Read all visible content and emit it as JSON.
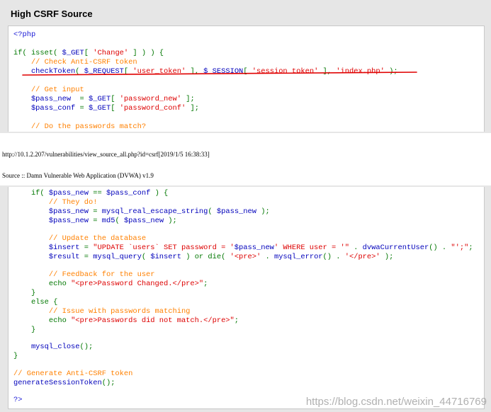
{
  "panel_title": "High CSRF Source",
  "footer_url": "http://10.1.2.207/vulnerabilities/view_source_all.php?id=csrf[2019/1/5 16:38:33]",
  "page_heading": "Source :: Damn Vulnerable Web Application (DVWA) v1.9",
  "watermark": "https://blog.csdn.net/weixin_44716769",
  "colors": {
    "underline": "#e00000",
    "comment": "#ff8000",
    "string": "#dd0000",
    "variable": "#0000bb",
    "keyword": "#007700"
  },
  "code_top": {
    "l1": "<?php",
    "l3a": "if( isset( ",
    "l3b": "$_GET",
    "l3c": "[ ",
    "l3d": "'Change'",
    "l3e": " ] ) ) {",
    "l4": "    // Check Anti-CSRF token",
    "l5a": "    checkToken",
    "l5b": "( ",
    "l5c": "$_REQUEST",
    "l5d": "[ ",
    "l5e": "'user_token'",
    "l5f": " ], ",
    "l5g": "$_SESSION",
    "l5h": "[ ",
    "l5i": "'session_token'",
    "l5j": " ], ",
    "l5k": "'index.php'",
    "l5l": " );",
    "l7": "    // Get input",
    "l8a": "    $pass_new",
    "l8b": "  = ",
    "l8c": "$_GET",
    "l8d": "[ ",
    "l8e": "'password_new'",
    "l8f": " ];",
    "l9a": "    $pass_conf",
    "l9b": " = ",
    "l9c": "$_GET",
    "l9d": "[ ",
    "l9e": "'password_conf'",
    "l9f": " ];",
    "l11": "    // Do the passwords match?"
  },
  "code_bottom": {
    "b1a": "    if( ",
    "b1b": "$pass_new",
    "b1c": " == ",
    "b1d": "$pass_conf",
    "b1e": " ) {",
    "b2": "        // They do!",
    "b3a": "        $pass_new",
    "b3b": " = ",
    "b3c": "mysql_real_escape_string",
    "b3d": "( ",
    "b3e": "$pass_new",
    "b3f": " );",
    "b4a": "        $pass_new",
    "b4b": " = ",
    "b4c": "md5",
    "b4d": "( ",
    "b4e": "$pass_new",
    "b4f": " );",
    "b6": "        // Update the database",
    "b7a": "        $insert",
    "b7b": " = ",
    "b7c": "\"UPDATE `users` SET password = '",
    "b7d": "$pass_new",
    "b7e": "' WHERE user = '\"",
    "b7f": " . ",
    "b7g": "dvwaCurrentUser",
    "b7h": "() . ",
    "b7i": "\"';\"",
    "b7j": ";",
    "b8a": "        $result",
    "b8b": " = ",
    "b8c": "mysql_query",
    "b8d": "( ",
    "b8e": "$insert",
    "b8f": " ) or die( ",
    "b8g": "'<pre>'",
    "b8h": " . ",
    "b8i": "mysql_error",
    "b8j": "() . ",
    "b8k": "'</pre>'",
    "b8l": " );",
    "b10": "        // Feedback for the user",
    "b11a": "        echo ",
    "b11b": "\"<pre>Password Changed.</pre>\"",
    "b11c": ";",
    "b12": "    }",
    "b13": "    else {",
    "b14": "        // Issue with passwords matching",
    "b15a": "        echo ",
    "b15b": "\"<pre>Passwords did not match.</pre>\"",
    "b15c": ";",
    "b16": "    }",
    "b18a": "    mysql_close",
    "b18b": "();",
    "b19": "}",
    "b21": "// Generate Anti-CSRF token",
    "b22a": "generateSessionToken",
    "b22b": "();",
    "b24": "?>"
  }
}
